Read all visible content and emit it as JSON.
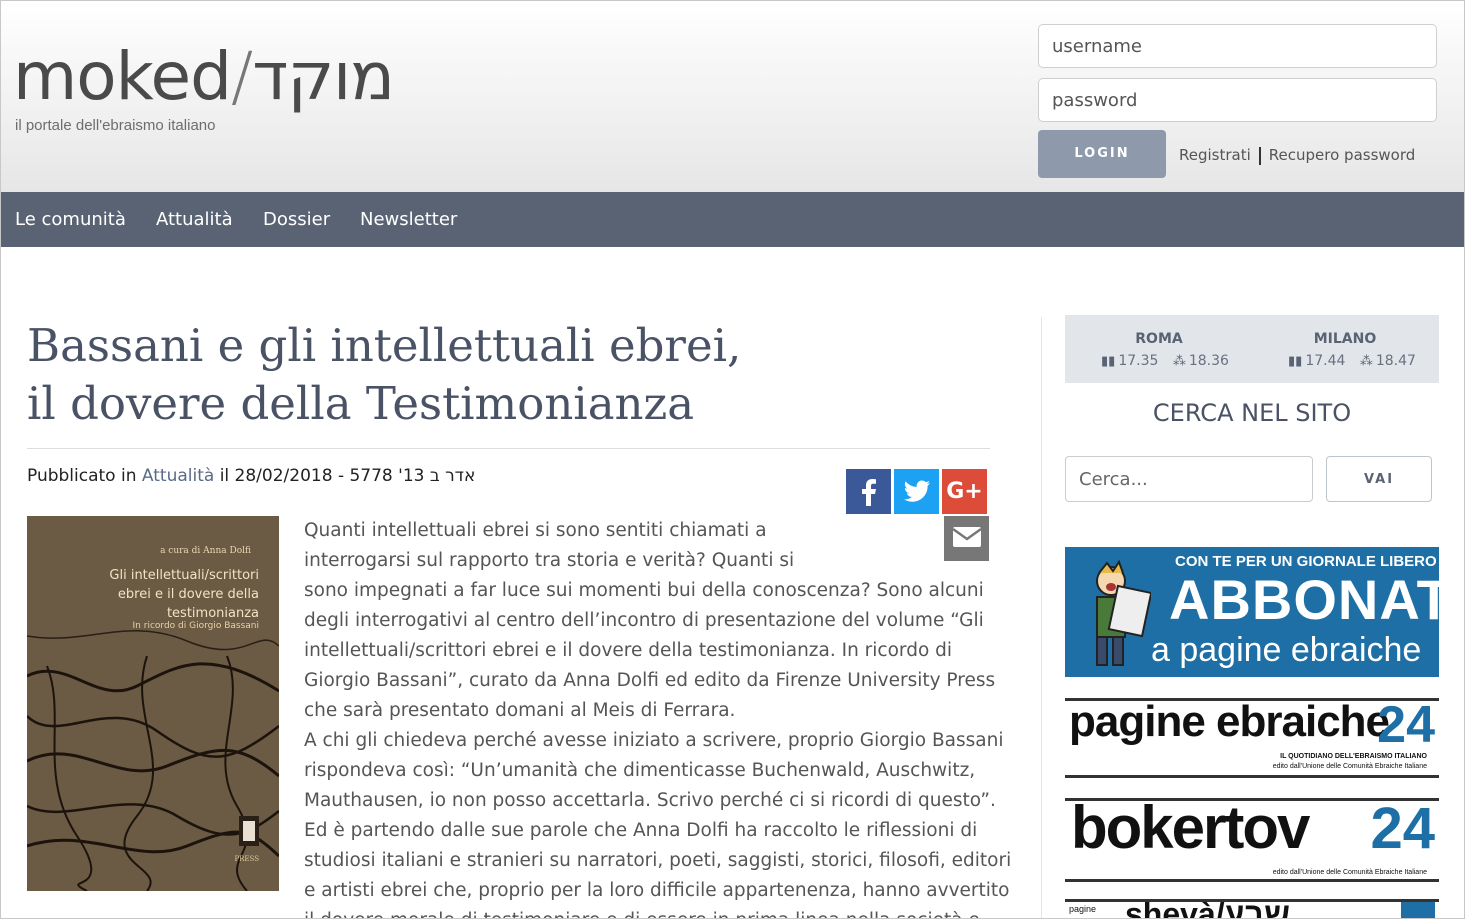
{
  "header": {
    "logo_latin": "moked",
    "logo_slash": "/",
    "logo_hebrew": "מוקד",
    "tagline": "il portale dell'ebraismo italiano",
    "username_placeholder": "username",
    "password_placeholder": "password",
    "login_label": "LOGIN",
    "register_label": "Registrati",
    "recover_label": "Recupero password"
  },
  "nav": {
    "items": [
      "Le comunità",
      "Attualità",
      "Dossier",
      "Newsletter"
    ]
  },
  "article": {
    "title_line1": "Bassani e gli intellettuali ebrei,",
    "title_line2": "il dovere della Testimonianza",
    "meta_prefix": "Pubblicato in",
    "meta_category": "Attualità",
    "meta_suffix": "il 28/02/2018 - 5778 '13 אדר ב",
    "share": {
      "facebook_icon": "facebook-icon",
      "twitter_icon": "twitter-icon",
      "gplus_label": "G+",
      "email_icon": "email-icon",
      "facebook_color": "#3b5998",
      "twitter_color": "#1da1f2",
      "gplus_color": "#dd4b39",
      "email_color": "#777777"
    },
    "cover": {
      "author": "a cura di Anna Dolfi",
      "title_l1": "Gli intellettuali/scrittori",
      "title_l2": "ebrei e il dovere della",
      "title_l3": "testimonianza",
      "subtitle": "In ricordo di Giorgio Bassani",
      "publisher": "PRESS"
    },
    "lines": [
      "Quanti intellettuali ebrei si sono sentiti chiamati a",
      "interrogarsi sul rapporto tra storia e verità? Quanti si",
      "sono impegnati a far luce sui momenti bui della conoscenza? Sono alcuni",
      "degli interrogativi al centro dell’incontro di presentazione del volume “Gli",
      "intellettuali/scrittori ebrei e il dovere della testimonianza. In ricordo di",
      "Giorgio Bassani”, curato da Anna Dolfi ed edito da Firenze University Press",
      "che sarà presentato domani al Meis di Ferrara.",
      "A chi gli chiedeva perché avesse iniziato a scrivere, proprio Giorgio Bassani",
      "rispondeva così: “Un’umanità che dimenticasse Buchenwald, Auschwitz,",
      "Mauthausen, io non posso accettarla. Scrivo perché ci si ricordi di questo”.",
      "Ed è partendo dalle sue parole che Anna Dolfi ha raccolto le riflessioni di",
      "studiosi italiani e stranieri su narratori, poeti, saggisti, storici, filosofi, editori",
      "e artisti ebrei che, proprio per la loro difficile appartenenza, hanno avvertito",
      "il dovere morale di testimoniare e di essere in prima linea nella società e"
    ]
  },
  "sidebar": {
    "times": [
      {
        "city": "ROMA",
        "candle": "17.35",
        "havdalah": "18.36"
      },
      {
        "city": "MILANO",
        "candle": "17.44",
        "havdalah": "18.47"
      }
    ],
    "search_title": "CERCA NEL SITO",
    "search_placeholder": "Cerca...",
    "search_button": "VAI",
    "banners": {
      "abbonati_top": "CON TE PER UN GIORNALE LIBERO E AUTOREVOLE",
      "abbonati_big": "ABBONATI",
      "abbonati_small": "a pagine ebraiche",
      "pe24_name": "pagine ebraiche",
      "pe24_num": "24",
      "pe24_sub1": "IL QUOTIDIANO DELL'EBRAISMO ITALIANO",
      "pe24_sub2": "edito dall'Unione delle Comunità Ebraiche Italiane",
      "bt24_name": "bokertov",
      "bt24_num": "24",
      "bt24_sub": "edito dall'Unione delle Comunità Ebraiche Italiane",
      "shev_pg": "pagine",
      "shev_name": "shevà/שבע"
    }
  },
  "colors": {
    "nav_bg": "#5a6373",
    "login_btn": "#8e9aab",
    "title_text": "#4a5266",
    "banner_blue": "#1e6fa6"
  }
}
